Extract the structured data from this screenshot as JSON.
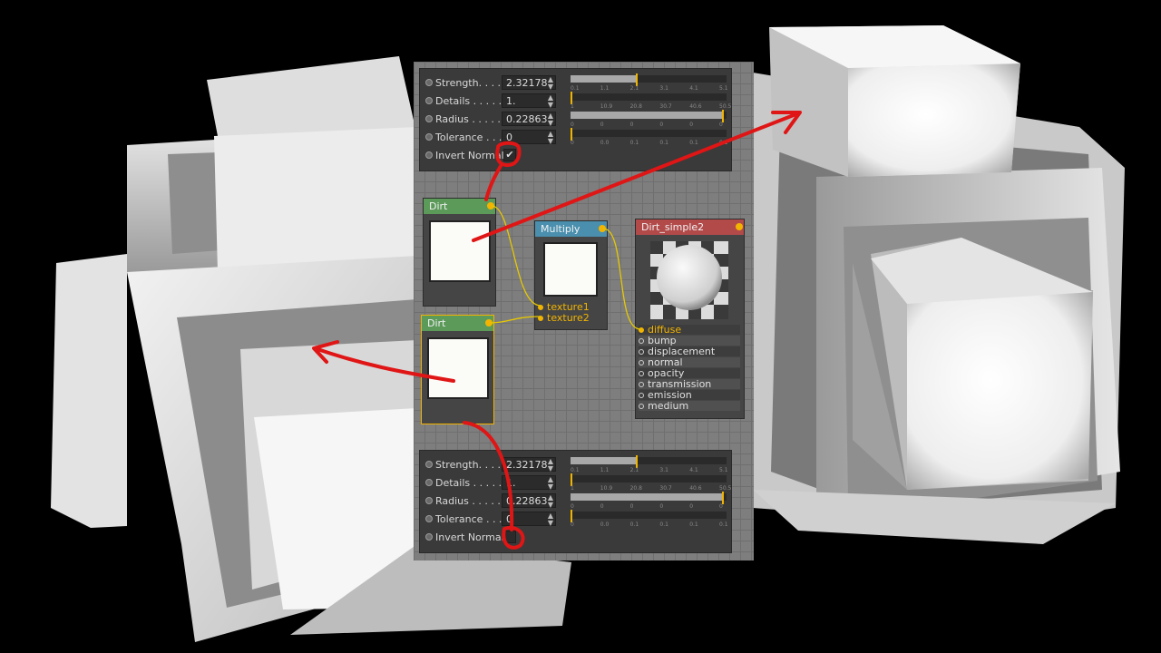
{
  "colors": {
    "background": "#000000",
    "editor_grid": "#7e7e7e",
    "param_panel": "#3a3a3a",
    "accent_yellow": "#f2b400",
    "dirt_header": "#5c9a5a",
    "multiply_header": "#4a8fae",
    "dirt_simple_header": "#b24a4a",
    "annotation_red": "#e01515"
  },
  "params_top": {
    "strength": {
      "label": "Strength. . . .",
      "value": "2.32178"
    },
    "details": {
      "label": "Details . . . . .",
      "value": "1."
    },
    "radius": {
      "label": "Radius . . . . .",
      "value": "0.22863"
    },
    "tolerance": {
      "label": "Tolerance . . .",
      "value": "0"
    },
    "invert_normal": {
      "label": "Invert Normal",
      "checked": true,
      "mark": "✔"
    }
  },
  "params_bottom": {
    "strength": {
      "label": "Strength. . . .",
      "value": "2.32178"
    },
    "details": {
      "label": "Details . . . . .",
      "value": "1."
    },
    "radius": {
      "label": "Radius . . . . .",
      "value": "0.22863"
    },
    "tolerance": {
      "label": "Tolerance . . .",
      "value": "0"
    },
    "invert_normal": {
      "label": "Invert Normal",
      "checked": false
    }
  },
  "sliders": {
    "strength": {
      "ticks": [
        "0.1",
        "1.1",
        "2.1",
        "3.1",
        "4.1",
        "5.1"
      ],
      "level": 0.42
    },
    "details": {
      "ticks": [
        "1",
        "10.9",
        "20.8",
        "30.7",
        "40.6",
        "50.5"
      ],
      "level": 0.0
    },
    "radius": {
      "ticks": [
        "0",
        "0",
        "0",
        "0",
        "0",
        "0"
      ],
      "level": 0.97
    },
    "tolerance": {
      "ticks": [
        "0",
        "0.0",
        "0.1",
        "0.1",
        "0.1",
        "0.1"
      ],
      "level": 0.0
    }
  },
  "nodes": {
    "dirt1": {
      "title": "Dirt"
    },
    "dirt2": {
      "title": "Dirt"
    },
    "multiply": {
      "title": "Multiply",
      "inputs": [
        "texture1",
        "texture2"
      ]
    },
    "dirt_simple": {
      "title": "Dirt_simple2",
      "inputs": [
        "diffuse",
        "bump",
        "displacement",
        "normal",
        "opacity",
        "transmission",
        "emission",
        "medium"
      ]
    }
  },
  "icons": {
    "param_dot": "param-dot-icon",
    "output_pin": "output-pin-icon",
    "input_pin": "input-pin-icon",
    "spinner": "spinner-arrows-icon",
    "checkmark": "checkmark-icon"
  }
}
